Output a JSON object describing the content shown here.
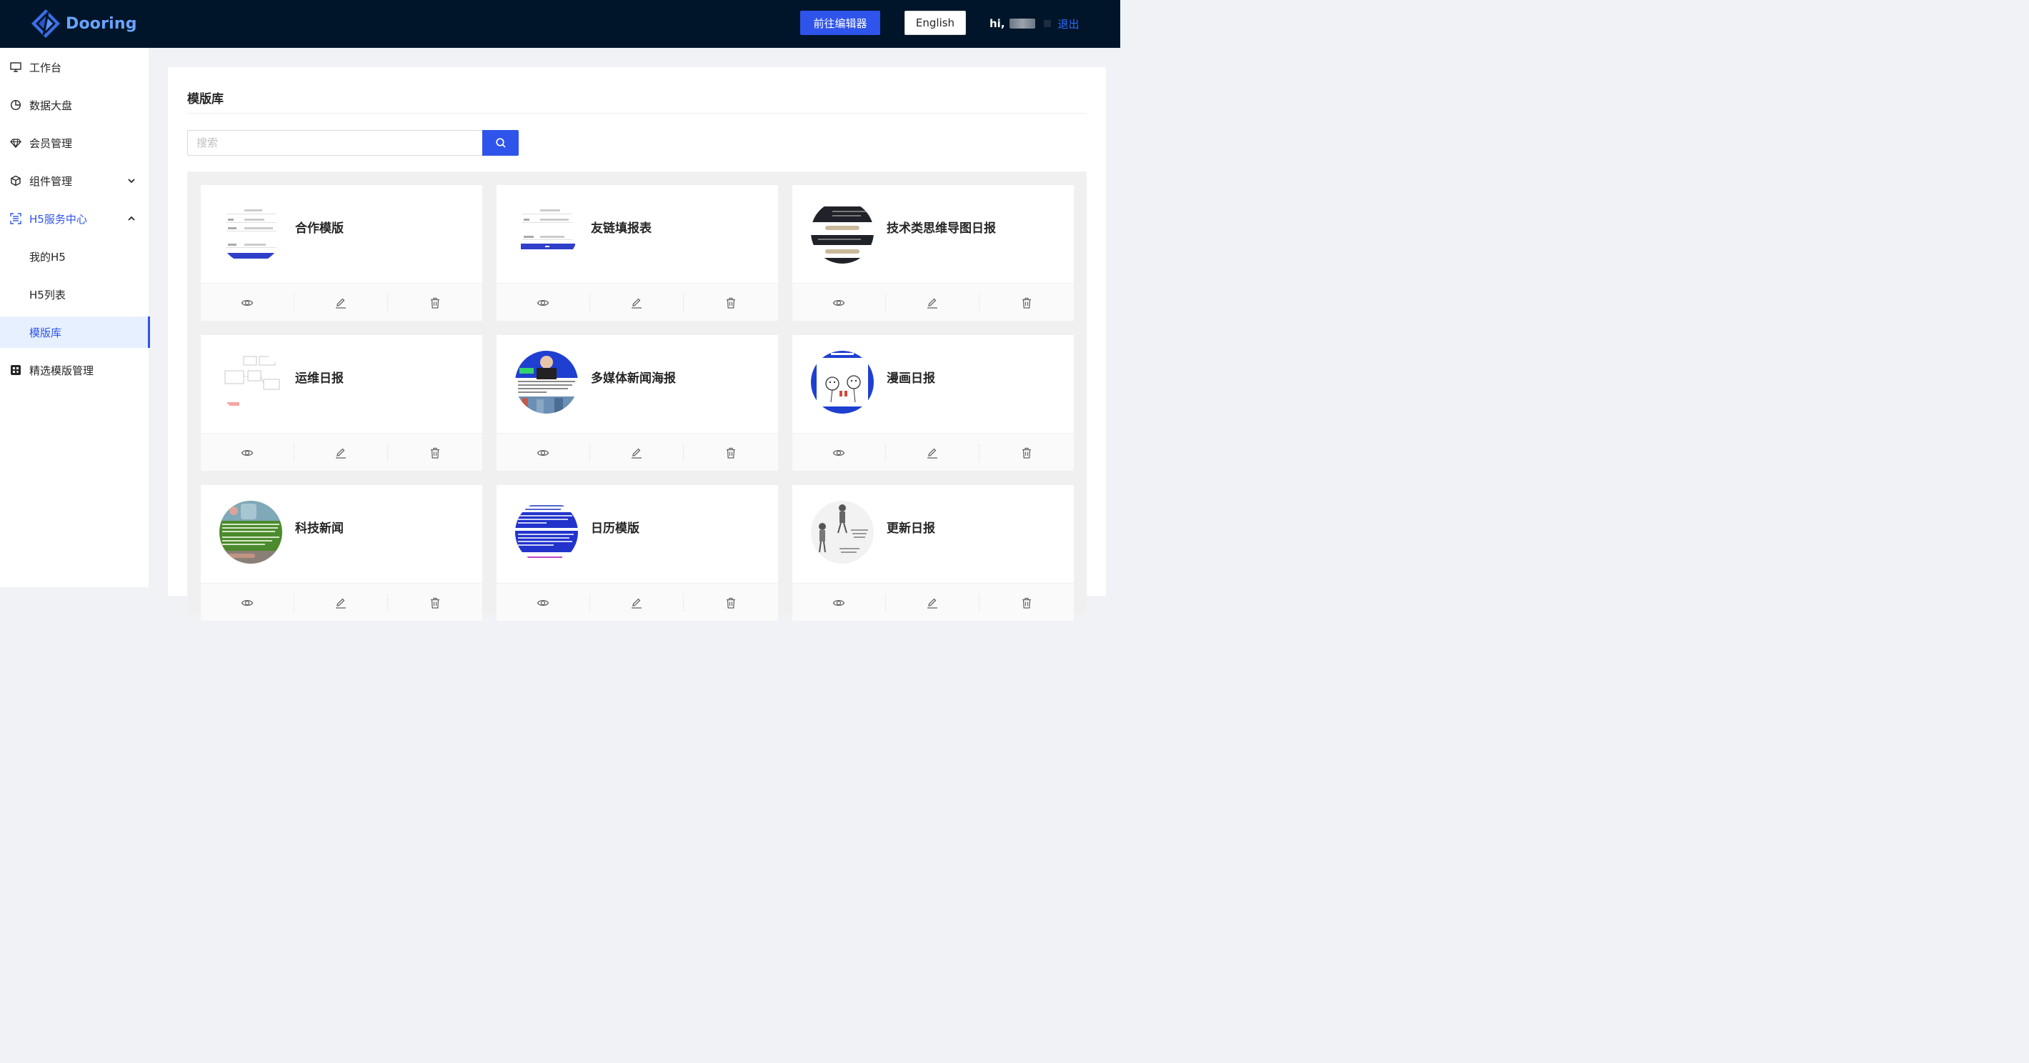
{
  "header": {
    "logo_text": "Dooring",
    "editor_button": "前往编辑器",
    "language_button": "English",
    "user_greeting": "hi,",
    "logout": "退出"
  },
  "sidebar": {
    "items": [
      {
        "label": "工作台",
        "icon": "desktop-icon"
      },
      {
        "label": "数据大盘",
        "icon": "pie-chart-icon"
      },
      {
        "label": "会员管理",
        "icon": "diamond-icon"
      },
      {
        "label": "组件管理",
        "icon": "cube-icon",
        "expandable": true,
        "expanded": false
      },
      {
        "label": "H5服务中心",
        "icon": "scan-icon",
        "expandable": true,
        "expanded": true
      },
      {
        "label": "我的H5"
      },
      {
        "label": "H5列表"
      },
      {
        "label": "模版库",
        "selected": true
      },
      {
        "label": "精选模版管理",
        "icon": "apps-icon"
      }
    ]
  },
  "main": {
    "title": "模版库",
    "search_placeholder": "搜索",
    "cards": [
      {
        "name": "合作模版"
      },
      {
        "name": "友链填报表"
      },
      {
        "name": "技术类思维导图日报"
      },
      {
        "name": "运维日报"
      },
      {
        "name": "多媒体新闻海报"
      },
      {
        "name": "漫画日报"
      },
      {
        "name": "科技新闻"
      },
      {
        "name": "日历模版"
      },
      {
        "name": "更新日报"
      }
    ]
  },
  "colors": {
    "header_bg": "#001529",
    "primary": "#2f54eb",
    "logout_link": "#2f6bff"
  }
}
